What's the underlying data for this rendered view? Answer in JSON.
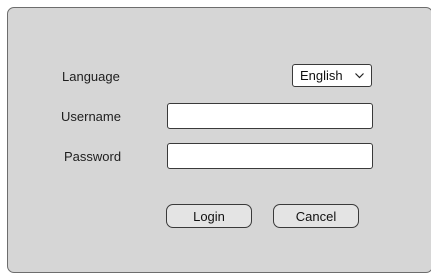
{
  "form": {
    "language_label": "Language",
    "language_selected": "English",
    "username_label": "Username",
    "username_value": "",
    "password_label": "Password",
    "password_value": "",
    "login_label": "Login",
    "cancel_label": "Cancel"
  },
  "icons": {
    "dropdown": "chevron-down-icon"
  },
  "colors": {
    "panel_background": "#d6d6d6",
    "border": "#3a3a3a",
    "button_background": "#e4e4e4"
  }
}
